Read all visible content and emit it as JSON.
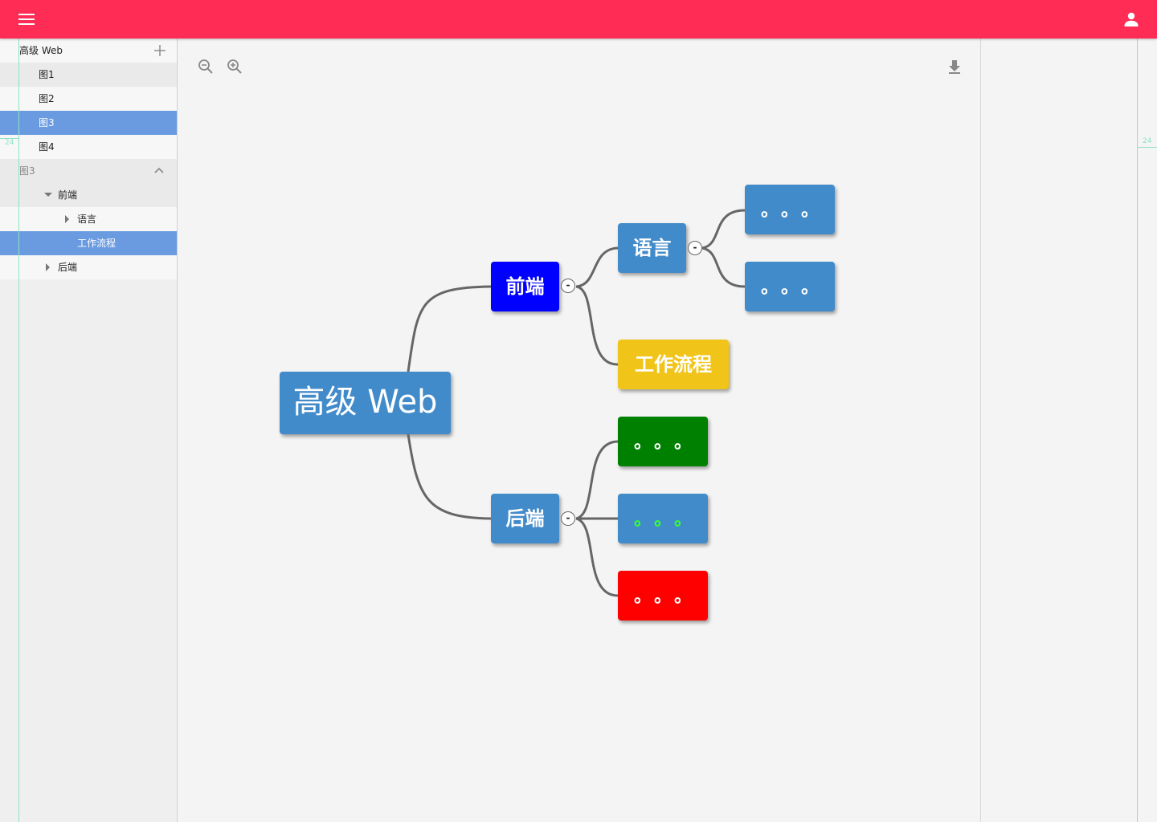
{
  "sidebar": {
    "project_title": "高级 Web",
    "maps": [
      "图1",
      "图2",
      "图3",
      "图4"
    ],
    "section_title": "图3",
    "tree": {
      "front": "前端",
      "lang": "语言",
      "workflow": "工作流程",
      "back": "后端"
    }
  },
  "guides": {
    "left_label": "24",
    "right_label": "24"
  },
  "mindmap": {
    "root": "高级 Web",
    "front": "前端",
    "lang": "语言",
    "workflow": "工作流程",
    "back": "后端",
    "ellipsis": "。。。",
    "toggle": "-"
  },
  "colors": {
    "topbar": "#ff2d55",
    "node_blue": "#428bca",
    "front": "#0000ff",
    "workflow": "#f0c419",
    "green": "#008000",
    "red": "#ff0000",
    "selected": "#6a9be0",
    "guide": "#8fe2c4"
  },
  "icons": [
    "menu-icon",
    "user-icon",
    "plus-icon",
    "chevron-up-icon",
    "zoom-out-icon",
    "zoom-in-icon",
    "download-icon"
  ]
}
